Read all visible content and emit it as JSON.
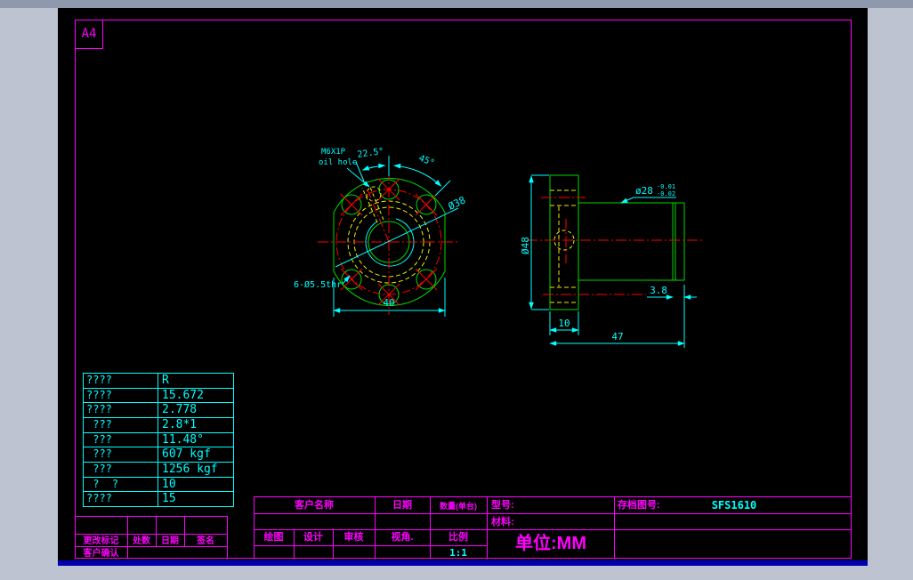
{
  "sheet": {
    "size_label": "A4"
  },
  "param_table": {
    "rows": [
      {
        "label": "????",
        "value": "R"
      },
      {
        "label": "????",
        "value": "15.672"
      },
      {
        "label": "????",
        "value": "2.778"
      },
      {
        "label": " ???",
        "value": "2.8*1"
      },
      {
        "label": " ???",
        "value": "11.48°"
      },
      {
        "label": " ???",
        "value": "607 kgf"
      },
      {
        "label": " ???",
        "value": "1256 kgf"
      },
      {
        "label": " ?  ?",
        "value": "10"
      },
      {
        "label": "????",
        "value": "15"
      }
    ]
  },
  "title_block": {
    "customer_name": "客户名称",
    "date": "日期",
    "quantity": "数量(单台)",
    "model": "型号:",
    "material": "材料:",
    "archive_no": "存档图号:",
    "archive_value": "SFS1610",
    "draft": "绘图",
    "design": "设计",
    "review": "审核",
    "view_angle": "视角.",
    "scale_label": "比例",
    "scale_value": "1:1",
    "unit": "单位:MM"
  },
  "revision_block": {
    "change_mark": "更改标记",
    "count": "处数",
    "date": "日期",
    "signature": "签名",
    "customer_confirm": "客户确认"
  },
  "front_view": {
    "oil_hole_line1": "M6X1P",
    "oil_hole_line2": "oil hole",
    "angle_small": "22.5°",
    "angle_large": "45°",
    "bolt_circle_dia": "Ø38",
    "bolt_holes": "6-Ø5.5thr",
    "width": "40"
  },
  "side_view": {
    "flange_dia": "Ø48",
    "body_dia": "ø28",
    "body_dia_tol_upper": "-0.01",
    "body_dia_tol_lower": "-0.02",
    "groove": "3.8",
    "flange_thickness": "10",
    "total_length": "47"
  },
  "colors": {
    "frame_magenta": "#ff00ff",
    "dimension_cyan": "#00ffff",
    "outline_green": "#00d900",
    "centerline_red": "#ff0000",
    "hidden_yellow": "#f0f000"
  }
}
